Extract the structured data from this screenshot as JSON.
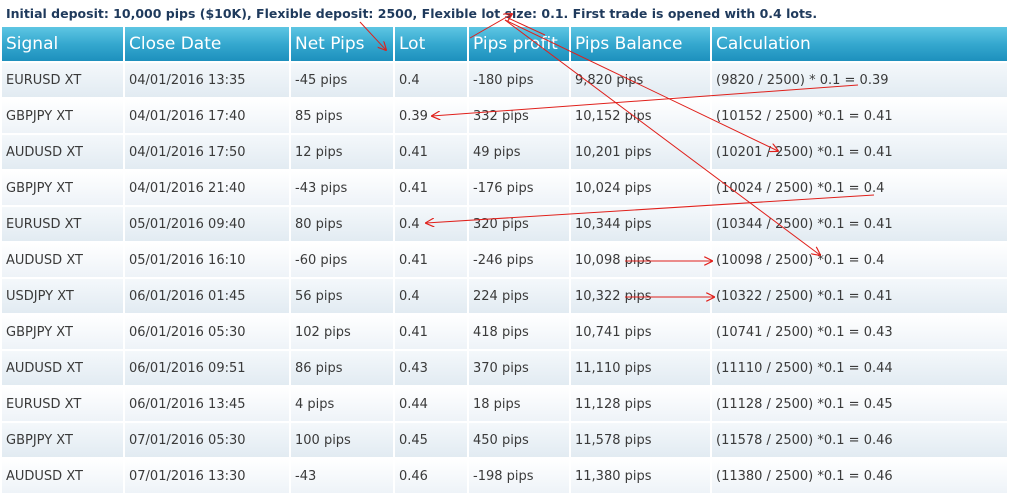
{
  "caption": "Initial deposit: 10,000 pips ($10K), Flexible deposit: 2500, Flexible lot size: 0.1. First trade is opened with 0.4 lots.",
  "headers": [
    "Signal",
    "Close Date",
    "Net Pips",
    "Lot",
    "Pips profit",
    "Pips Balance",
    "Calculation"
  ],
  "rows": [
    [
      "EURUSD XT",
      "04/01/2016 13:35",
      "-45 pips",
      "0.4",
      "-180 pips",
      "9,820 pips",
      "(9820 / 2500) * 0.1 = 0.39"
    ],
    [
      "GBPJPY XT",
      "04/01/2016 17:40",
      "85 pips",
      "0.39",
      "332 pips",
      "10,152 pips",
      "(10152 / 2500) *0.1 = 0.41"
    ],
    [
      "AUDUSD XT",
      "04/01/2016 17:50",
      "12 pips",
      "0.41",
      "49 pips",
      "10,201 pips",
      "(10201 / 2500) *0.1 = 0.41"
    ],
    [
      "GBPJPY XT",
      "04/01/2016 21:40",
      "-43 pips",
      "0.41",
      "-176 pips",
      "10,024 pips",
      "(10024 / 2500) *0.1 = 0.4"
    ],
    [
      "EURUSD XT",
      "05/01/2016 09:40",
      "80 pips",
      "0.4",
      "320 pips",
      "10,344 pips",
      "(10344 / 2500) *0.1 = 0.41"
    ],
    [
      "AUDUSD XT",
      "05/01/2016 16:10",
      "-60 pips",
      "0.41",
      "-246 pips",
      "10,098 pips",
      "(10098 / 2500) *0.1 = 0.4"
    ],
    [
      "USDJPY XT",
      "06/01/2016 01:45",
      "56 pips",
      "0.4",
      "224 pips",
      "10,322 pips",
      "(10322 / 2500) *0.1 = 0.41"
    ],
    [
      "GBPJPY XT",
      "06/01/2016 05:30",
      "102 pips",
      "0.41",
      "418 pips",
      "10,741 pips",
      "(10741 / 2500) *0.1 = 0.43"
    ],
    [
      "AUDUSD XT",
      "06/01/2016 09:51",
      "86 pips",
      "0.43",
      "370 pips",
      "11,110 pips",
      "(11110 / 2500) *0.1 = 0.44"
    ],
    [
      "EURUSD XT",
      "06/01/2016 13:45",
      "4 pips",
      "0.44",
      "18 pips",
      "11,128 pips",
      "(11128 / 2500) *0.1 = 0.45"
    ],
    [
      "GBPJPY XT",
      "07/01/2016 05:30",
      "100 pips",
      "0.45",
      "450 pips",
      "11,578 pips",
      "(11578 / 2500) *0.1 = 0.46"
    ],
    [
      "AUDUSD XT",
      "07/01/2016 13:30",
      "-43",
      "0.46",
      "-198 pips",
      "11,380 pips",
      "(11380 / 2500) *0.1 = 0.46"
    ]
  ],
  "colors": {
    "header": "#35a8cf",
    "arrow": "#e0201b"
  }
}
